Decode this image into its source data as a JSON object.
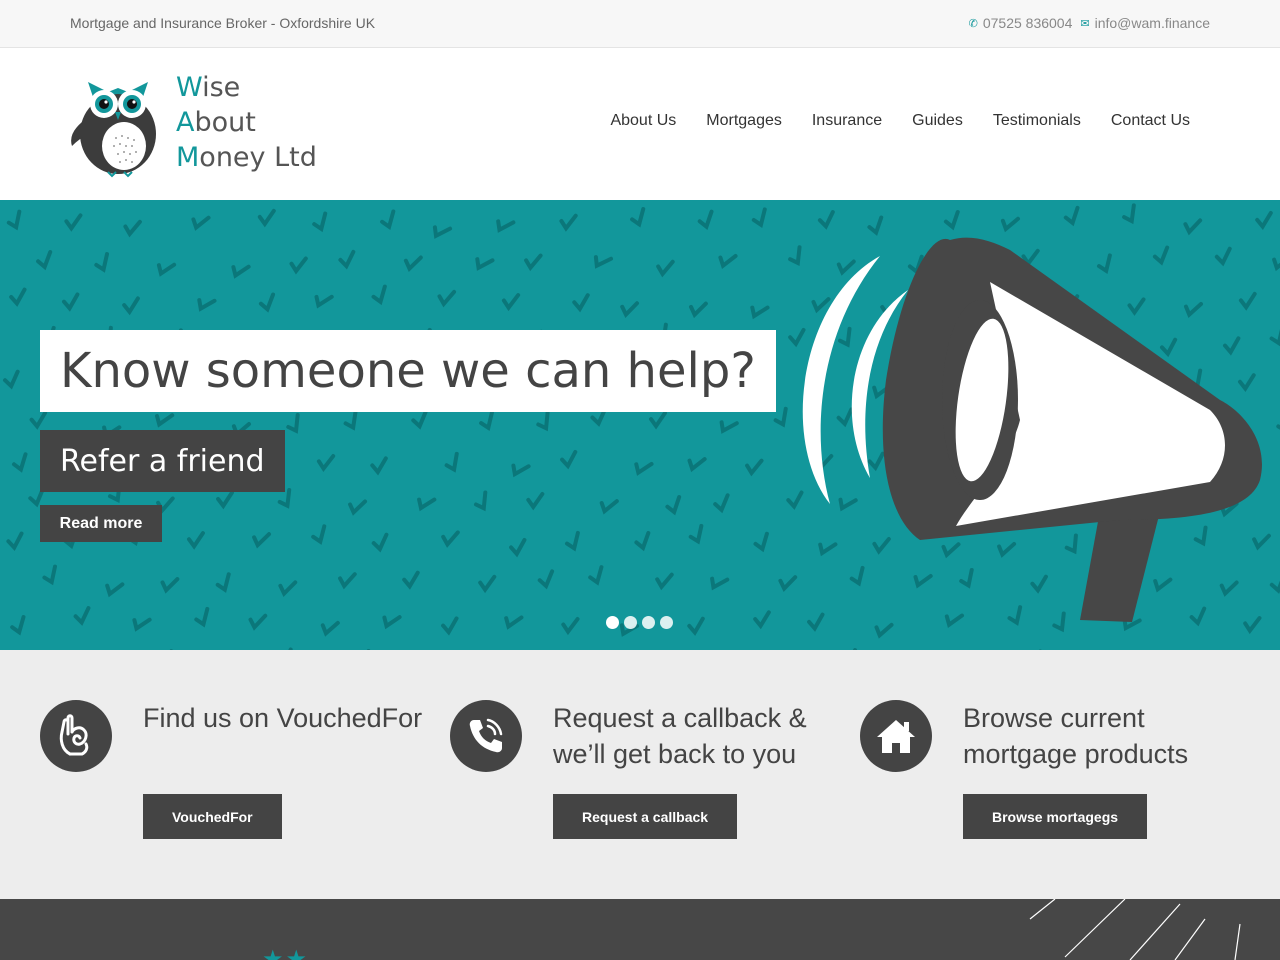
{
  "topbar": {
    "tagline": "Mortgage and Insurance Broker - Oxfordshire UK",
    "phone": "07525 836004",
    "email": "info@wam.finance",
    "phone_icon": "phone-icon",
    "email_icon": "envelope-icon"
  },
  "header": {
    "logo": {
      "line1_cap": "W",
      "line1_rest": "ise",
      "line2_cap": "A",
      "line2_rest": "bout",
      "line3_cap": "M",
      "line3_rest": "oney Ltd"
    },
    "nav": [
      {
        "label": "About Us"
      },
      {
        "label": "Mortgages"
      },
      {
        "label": "Insurance"
      },
      {
        "label": "Guides"
      },
      {
        "label": "Testimonials"
      },
      {
        "label": "Contact Us"
      }
    ]
  },
  "hero": {
    "title": "Know someone we can help?",
    "subtitle": "Refer a friend",
    "button": "Read more",
    "slides_count": 4,
    "active_slide": 1
  },
  "features": [
    {
      "icon": "ok-hand-icon",
      "title": "Find us on VouchedFor",
      "button": "VouchedFor"
    },
    {
      "icon": "phone-callback-icon",
      "title": "Request a callback & we’ll get back to you",
      "button": "Request a callback"
    },
    {
      "icon": "house-icon",
      "title": "Browse current mortgage products",
      "button": "Browse mortagegs"
    }
  ],
  "colors": {
    "accent": "#12979b",
    "dark": "#444444",
    "light_bg": "#ededed"
  }
}
